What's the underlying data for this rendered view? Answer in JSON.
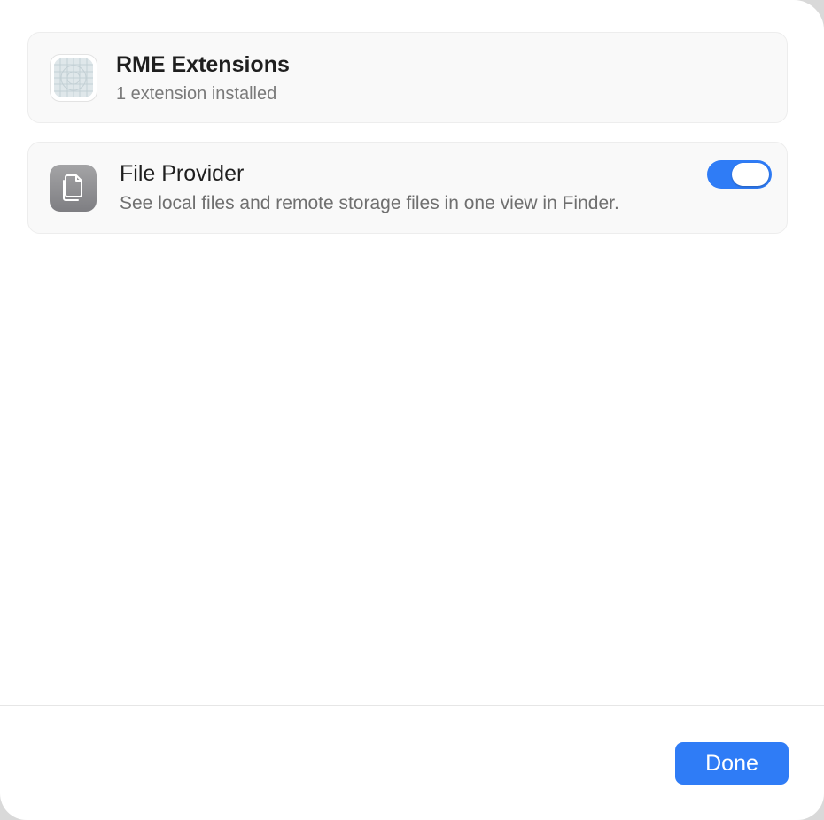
{
  "app": {
    "name": "RME Extensions",
    "subtitle": "1 extension installed",
    "icon": "rme-app-icon"
  },
  "extension": {
    "name": "File Provider",
    "description": "See local files and remote storage files in one view in Finder.",
    "icon": "documents-icon",
    "enabled": true
  },
  "footer": {
    "done_label": "Done"
  },
  "colors": {
    "accent": "#2f7cf6",
    "card_background": "#f9f9f9",
    "secondary_text": "#7a7a7a"
  }
}
